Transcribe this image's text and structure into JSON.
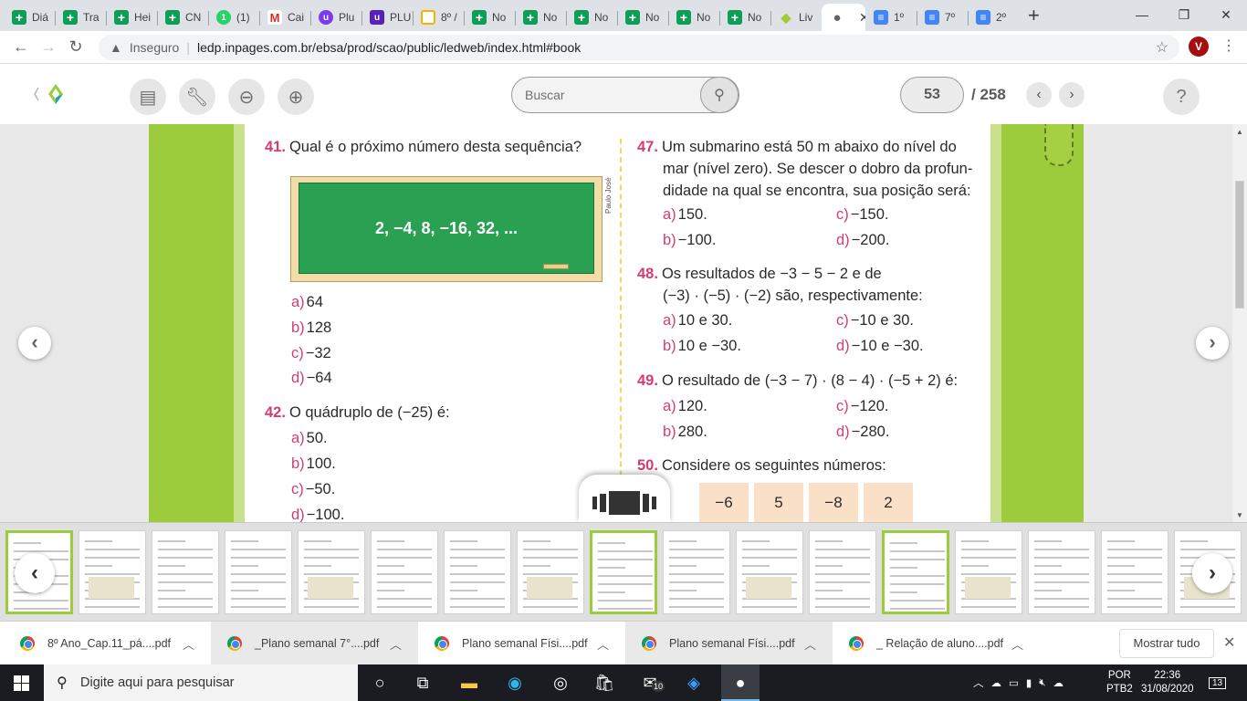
{
  "browser": {
    "tabs": [
      {
        "label": "Diá",
        "icon": "sheets-icon",
        "color": "#0f9d58"
      },
      {
        "label": "Tra",
        "icon": "sheets-icon",
        "color": "#0f9d58"
      },
      {
        "label": "Hei",
        "icon": "sheets-icon",
        "color": "#0f9d58"
      },
      {
        "label": "CN",
        "icon": "sheets-icon",
        "color": "#0f9d58"
      },
      {
        "label": "(1)",
        "icon": "whatsapp-icon",
        "color": "#25d366"
      },
      {
        "label": "Cai",
        "icon": "gmail-icon",
        "color": "#ffffff"
      },
      {
        "label": "Plu",
        "icon": "plurall-icon",
        "color": "#7c3aed"
      },
      {
        "label": "PLU",
        "icon": "plurall-icon",
        "color": "#5b21b6"
      },
      {
        "label": "8º /",
        "icon": "slides-icon",
        "color": "#f4b400"
      },
      {
        "label": "No",
        "icon": "sheets-icon",
        "color": "#0f9d58"
      },
      {
        "label": "No",
        "icon": "sheets-icon",
        "color": "#0f9d58"
      },
      {
        "label": "No",
        "icon": "sheets-icon",
        "color": "#0f9d58"
      },
      {
        "label": "No",
        "icon": "sheets-icon",
        "color": "#0f9d58"
      },
      {
        "label": "No",
        "icon": "sheets-icon",
        "color": "#0f9d58"
      },
      {
        "label": "No",
        "icon": "sheets-icon",
        "color": "#0f9d58"
      },
      {
        "label": "Liv",
        "icon": "ledweb-icon",
        "color": "#9ccc3b"
      },
      {
        "label": "",
        "icon": "globe-icon",
        "color": "#5f6368",
        "active": true
      },
      {
        "label": "1º",
        "icon": "docs-icon",
        "color": "#4285f4"
      },
      {
        "label": "7º",
        "icon": "docs-icon",
        "color": "#4285f4"
      },
      {
        "label": "2º",
        "icon": "docs-icon",
        "color": "#4285f4"
      }
    ],
    "security_label": "Inseguro",
    "url": "ledp.inpages.com.br/ebsa/prod/scao/public/ledweb/index.html#book",
    "profile_initial": "V"
  },
  "reader": {
    "search_placeholder": "Buscar",
    "current_page": "53",
    "total_pages": "/ 258",
    "help": "?"
  },
  "page": {
    "q41": {
      "num": "41.",
      "text": "Qual é o próximo número desta sequência?",
      "board": "2, −4, 8, −16, 32, ...",
      "credit": "Paulo José",
      "options": [
        {
          "l": "a)",
          "t": "64"
        },
        {
          "l": "b)",
          "t": "128"
        },
        {
          "l": "c)",
          "t": "−32"
        },
        {
          "l": "d)",
          "t": "−64"
        }
      ]
    },
    "q42": {
      "num": "42.",
      "text": "O quádruplo de (−25) é:",
      "options": [
        {
          "l": "a)",
          "t": "50."
        },
        {
          "l": "b)",
          "t": "100."
        },
        {
          "l": "c)",
          "t": "−50."
        },
        {
          "l": "d)",
          "t": "−100."
        }
      ]
    },
    "q47": {
      "num": "47.",
      "lines": [
        "Um submarino está 50 m abaixo do nível do",
        "mar (nível zero). Se descer o dobro da profun-",
        "didade na qual se encontra, sua posição será:"
      ],
      "options": [
        {
          "l": "a)",
          "t": "150."
        },
        {
          "l": "c)",
          "t": "−150."
        },
        {
          "l": "b)",
          "t": "−100."
        },
        {
          "l": "d)",
          "t": "−200."
        }
      ]
    },
    "q48": {
      "num": "48.",
      "lines": [
        "Os resultados de −3 − 5 − 2 e de",
        "(−3) · (−5) · (−2) são, respectivamente:"
      ],
      "options": [
        {
          "l": "a)",
          "t": "10 e 30."
        },
        {
          "l": "c)",
          "t": "−10 e 30."
        },
        {
          "l": "b)",
          "t": "10 e −30."
        },
        {
          "l": "d)",
          "t": "−10 e −30."
        }
      ]
    },
    "q49": {
      "num": "49.",
      "text": "O resultado de (−3 − 7) · (8 − 4) · (−5 + 2) é:",
      "options": [
        {
          "l": "a)",
          "t": "120."
        },
        {
          "l": "c)",
          "t": "−120."
        },
        {
          "l": "b)",
          "t": "280."
        },
        {
          "l": "d)",
          "t": "−280."
        }
      ]
    },
    "q50": {
      "num": "50.",
      "text": "Considere os seguintes números:",
      "numbers": [
        "−6",
        "5",
        "−8",
        "2"
      ]
    }
  },
  "downloads": [
    "8º Ano_Cap.11_pá....pdf",
    "_Plano semanal 7°....pdf",
    "Plano semanal Físi....pdf",
    "Plano semanal Físi....pdf",
    "_ Relação de aluno....pdf"
  ],
  "downloads_show_all": "Mostrar tudo",
  "taskbar": {
    "search_placeholder": "Digite aqui para pesquisar",
    "mail_badge": "10",
    "lang1": "POR",
    "lang2": "PTB2",
    "time": "22:36",
    "date": "31/08/2020",
    "notif_count": "13"
  },
  "thumbnails": {
    "count": 17,
    "selected": [
      0,
      8,
      12
    ]
  }
}
